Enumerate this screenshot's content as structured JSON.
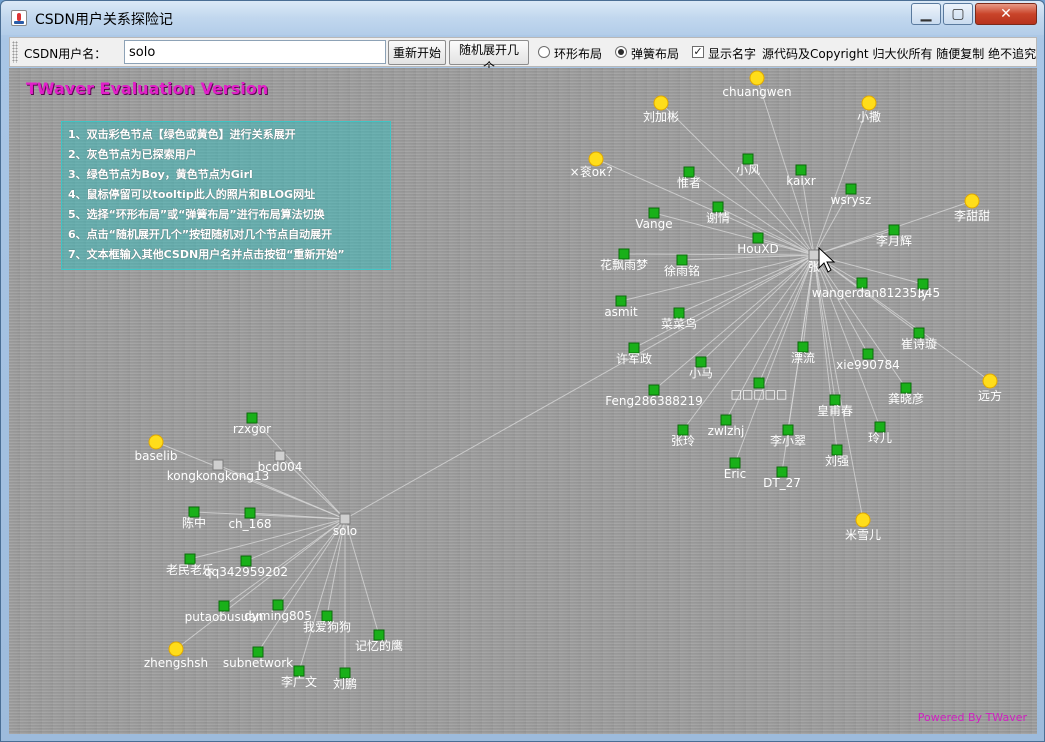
{
  "window": {
    "title": "CSDN用户关系探险记",
    "minimize": "▁",
    "maximize": "▢",
    "close": "✕"
  },
  "toolbar": {
    "username_label": "CSDN用户名：",
    "username_value": "solo",
    "restart_label": "重新开始",
    "random_expand_label": "随机展开几个",
    "circle_layout_label": "环形布局",
    "spring_layout_label": "弹簧布局",
    "selected_layout": "spring",
    "show_names_label": "显示名字",
    "show_names_checked": true,
    "copyright_text": "源代码及Copyright 归大伙所有 随便复制 绝不追究"
  },
  "canvas": {
    "eval_text": "TWaver Evaluation Version",
    "powered_text": "Powered By TWaver",
    "help": [
      "1、双击彩色节点【绿色或黄色】进行关系展开",
      "2、灰色节点为已探索用户",
      "3、绿色节点为Boy，黄色节点为Girl",
      "4、鼠标停留可以tooltip此人的照片和BLOG网址",
      "5、选择“环形布局”或“弹簧布局”进行布局算法切换",
      "6、点击“随机展开几个”按钮随机对几个节点自动展开",
      "7、文本框输入其他CSDN用户名并点击按钮“重新开始”"
    ],
    "colors": {
      "boy": "#19b019",
      "girl": "#ffdd1a",
      "explored": "#cfcfcf",
      "link": "#d9d9d9"
    },
    "nodes": [
      {
        "id": "zhang",
        "label": "张",
        "kind": "explored"
      },
      {
        "id": "solo",
        "label": "solo",
        "kind": "explored"
      },
      {
        "id": "kongkongkong13",
        "label": "kongkongkong13",
        "kind": "explored"
      },
      {
        "id": "bcd004",
        "label": "bcd004",
        "kind": "explored"
      },
      {
        "id": "chuangwen",
        "label": "chuangwen",
        "kind": "girl"
      },
      {
        "id": "liujiabin",
        "label": "刘加彬",
        "kind": "girl"
      },
      {
        "id": "xiaosa",
        "label": "小撒",
        "kind": "girl"
      },
      {
        "id": "xdiaok",
        "label": "×衮ок？",
        "kind": "girl"
      },
      {
        "id": "litiantian",
        "label": "李甜甜",
        "kind": "girl"
      },
      {
        "id": "yuanfang",
        "label": "远方",
        "kind": "girl"
      },
      {
        "id": "mixueer",
        "label": "米雪儿",
        "kind": "girl"
      },
      {
        "id": "baselib",
        "label": "baselib",
        "kind": "girl"
      },
      {
        "id": "zhengshsh",
        "label": "zhengshsh",
        "kind": "girl"
      },
      {
        "id": "weizhe",
        "label": "惟者",
        "kind": "boy"
      },
      {
        "id": "xiaofeng",
        "label": "小风",
        "kind": "boy"
      },
      {
        "id": "kaixr",
        "label": "kaixr",
        "kind": "boy"
      },
      {
        "id": "wsrysz",
        "label": "wsrysz",
        "kind": "boy"
      },
      {
        "id": "vange",
        "label": "Vange",
        "kind": "boy"
      },
      {
        "id": "xieqing",
        "label": "谢情",
        "kind": "boy"
      },
      {
        "id": "houxd",
        "label": "HouXD",
        "kind": "boy"
      },
      {
        "id": "liyuehui",
        "label": "李月辉",
        "kind": "boy"
      },
      {
        "id": "huapiao",
        "label": "花飘雨梦",
        "kind": "boy"
      },
      {
        "id": "xuyuming",
        "label": "徐雨铭",
        "kind": "boy"
      },
      {
        "id": "wangerdan",
        "label": "wangerdan81235345",
        "kind": "boy"
      },
      {
        "id": "ly",
        "label": "ly",
        "kind": "boy"
      },
      {
        "id": "asmit",
        "label": "asmit",
        "kind": "boy"
      },
      {
        "id": "caicainiao",
        "label": "菜菜鸟",
        "kind": "boy"
      },
      {
        "id": "cuishixuan",
        "label": "崔诗璇",
        "kind": "boy"
      },
      {
        "id": "xujunzheng",
        "label": "许军政",
        "kind": "boy"
      },
      {
        "id": "xiaoma",
        "label": "小马",
        "kind": "boy"
      },
      {
        "id": "piaoliu",
        "label": "漂流",
        "kind": "boy"
      },
      {
        "id": "xie990784",
        "label": "xie990784",
        "kind": "boy"
      },
      {
        "id": "boxes",
        "label": "□□□□□",
        "kind": "boy"
      },
      {
        "id": "feng",
        "label": "Feng286388219",
        "kind": "boy"
      },
      {
        "id": "gongxiaoyan",
        "label": "龚晓彦",
        "kind": "boy"
      },
      {
        "id": "huangfuchun",
        "label": "皇甫春",
        "kind": "boy"
      },
      {
        "id": "zhangling",
        "label": "张玲",
        "kind": "boy"
      },
      {
        "id": "zwlzhj",
        "label": "zwlzhj",
        "kind": "boy"
      },
      {
        "id": "lixiaocui",
        "label": "李小翠",
        "kind": "boy"
      },
      {
        "id": "linger",
        "label": "玲儿",
        "kind": "boy"
      },
      {
        "id": "liuqiang",
        "label": "刘强",
        "kind": "boy"
      },
      {
        "id": "eric",
        "label": "Eric",
        "kind": "boy"
      },
      {
        "id": "dt27",
        "label": "DT_27",
        "kind": "boy"
      },
      {
        "id": "rzxgor",
        "label": "rzxgor",
        "kind": "boy"
      },
      {
        "id": "chenzhong",
        "label": "陈中",
        "kind": "boy"
      },
      {
        "id": "ch168",
        "label": "ch_168",
        "kind": "boy"
      },
      {
        "id": "laomin",
        "label": "老民老乐",
        "kind": "boy"
      },
      {
        "id": "qq342959202",
        "label": "qq342959202",
        "kind": "boy"
      },
      {
        "id": "putaobusuan",
        "label": "putaobusuan",
        "kind": "boy"
      },
      {
        "id": "dyming805",
        "label": "dyming805",
        "kind": "boy"
      },
      {
        "id": "woaigougou",
        "label": "我爱狗狗",
        "kind": "boy"
      },
      {
        "id": "jiyideying",
        "label": "记忆的鹰",
        "kind": "boy"
      },
      {
        "id": "subnetwork",
        "label": "subnetwork",
        "kind": "boy"
      },
      {
        "id": "liguangwen",
        "label": "李广文",
        "kind": "boy"
      },
      {
        "id": "liupeng",
        "label": "刘鹏",
        "kind": "boy"
      }
    ]
  }
}
